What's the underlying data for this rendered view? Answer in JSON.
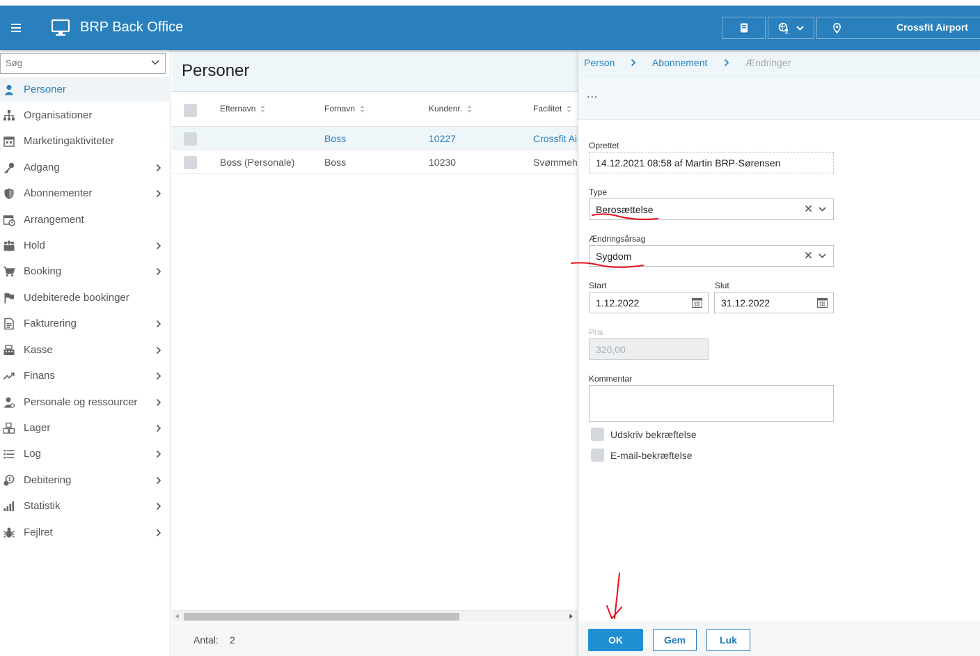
{
  "header": {
    "title": "BRP Back Office",
    "facility": "Crossfit Airport",
    "icons": [
      "menu-icon",
      "monitor-icon",
      "book-icon",
      "globe-user-icon",
      "location-pin-icon"
    ]
  },
  "sidebar": {
    "search_placeholder": "Søg",
    "items": [
      {
        "label": "Personer",
        "icon": "person-icon",
        "active": true,
        "chevron": false
      },
      {
        "label": "Organisationer",
        "icon": "org-chart-icon",
        "chevron": false
      },
      {
        "label": "Marketingaktiviteter",
        "icon": "calendar-star-icon",
        "chevron": false
      },
      {
        "label": "Adgang",
        "icon": "key-icon",
        "chevron": true
      },
      {
        "label": "Abonnementer",
        "icon": "shield-icon",
        "chevron": true
      },
      {
        "label": "Arrangement",
        "icon": "calendar-clock-icon",
        "chevron": false
      },
      {
        "label": "Hold",
        "icon": "group-icon",
        "chevron": true
      },
      {
        "label": "Booking",
        "icon": "cart-icon",
        "chevron": true
      },
      {
        "label": "Udebiterede bookinger",
        "icon": "flag-icon",
        "chevron": false
      },
      {
        "label": "Fakturering",
        "icon": "invoice-icon",
        "chevron": true
      },
      {
        "label": "Kasse",
        "icon": "cash-register-icon",
        "chevron": true
      },
      {
        "label": "Finans",
        "icon": "trend-icon",
        "chevron": true
      },
      {
        "label": "Personale og ressourcer",
        "icon": "staff-icon",
        "chevron": true
      },
      {
        "label": "Lager",
        "icon": "boxes-icon",
        "chevron": true
      },
      {
        "label": "Log",
        "icon": "list-icon",
        "chevron": true
      },
      {
        "label": "Debitering",
        "icon": "coin-icon",
        "chevron": true
      },
      {
        "label": "Statistik",
        "icon": "bar-chart-icon",
        "chevron": true
      },
      {
        "label": "Fejlret",
        "icon": "bug-icon",
        "chevron": true
      }
    ]
  },
  "main": {
    "title": "Personer",
    "columns": [
      "Efternavn",
      "Fornavn",
      "Kundenr.",
      "Facilitet"
    ],
    "rows": [
      {
        "efternavn": "",
        "fornavn": "Boss",
        "kundenr": "10227",
        "facilitet": "Crossfit Ai"
      },
      {
        "efternavn": "Boss (Personale)",
        "fornavn": "Boss",
        "kundenr": "10230",
        "facilitet": "Svømmeh"
      }
    ],
    "count_label": "Antal:",
    "count_value": "2"
  },
  "panel": {
    "breadcrumb": [
      "Person",
      "Abonnement",
      "Ændringer"
    ],
    "menu": "...",
    "fields": {
      "oprettet_label": "Oprettet",
      "oprettet_value": "14.12.2021 08:58 af Martin BRP-Sørensen",
      "type_label": "Type",
      "type_value": "Berosættelse",
      "aarsag_label": "Ændringsårsag",
      "aarsag_value": "Sygdom",
      "start_label": "Start",
      "start_value": "1.12.2022",
      "slut_label": "Slut",
      "slut_value": "31.12.2022",
      "pris_label": "Pris",
      "pris_value": "320,00",
      "kommentar_label": "Kommentar",
      "kommentar_value": ""
    },
    "checkboxes": [
      "Udskriv bekræftelse",
      "E-mail-bekræftelse"
    ],
    "buttons": {
      "ok": "OK",
      "gem": "Gem",
      "luk": "Luk"
    }
  },
  "colors": {
    "brand": "#2a80bd",
    "primary_button": "#1f8fd4",
    "annotation": "#e8101a"
  }
}
